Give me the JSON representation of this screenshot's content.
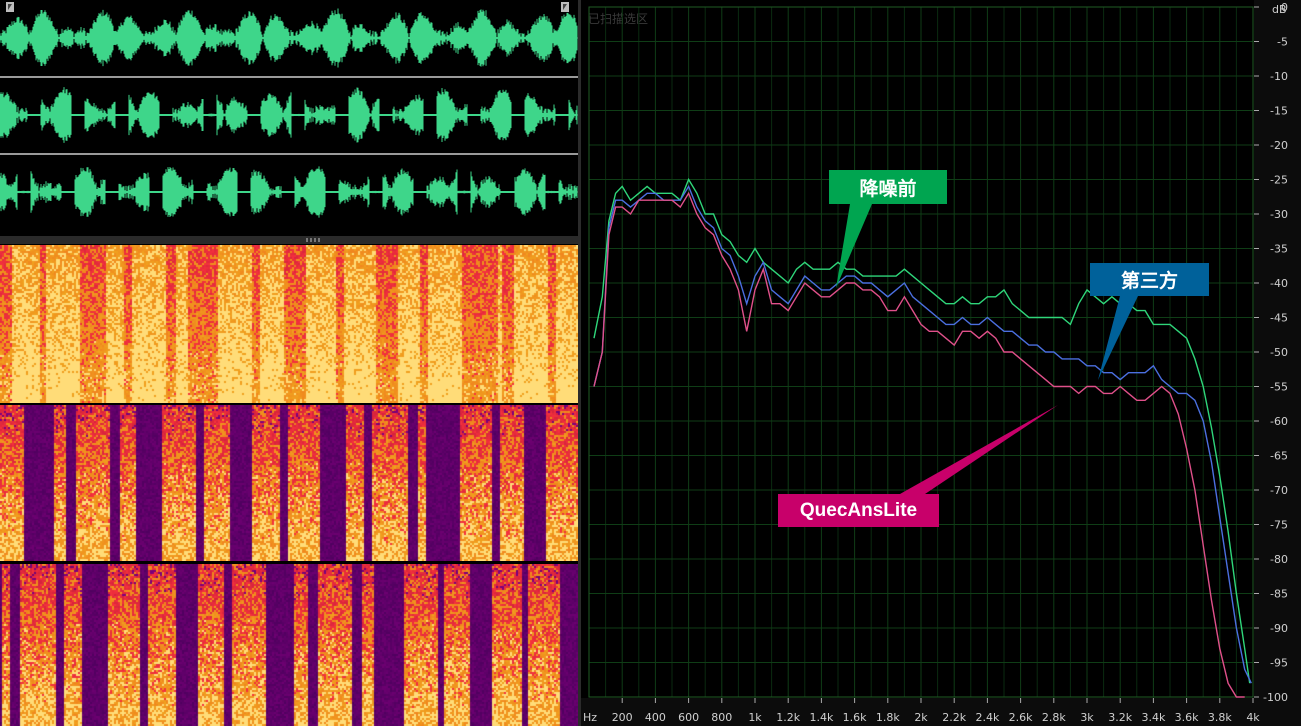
{
  "waveform": {
    "tracks": [
      {
        "id": "original"
      },
      {
        "id": "third-party"
      },
      {
        "id": "quecanslite"
      }
    ],
    "color": "#3ed68a"
  },
  "spectrum_panel": {
    "region_label": "已扫描选区",
    "callouts": {
      "before": {
        "label": "降噪前",
        "color": "#00a550"
      },
      "third_party": {
        "label": "第三方",
        "color": "#00619a"
      },
      "quecans": {
        "label": "QuecAnsLite",
        "color": "#c8006a"
      }
    }
  },
  "chart_data": {
    "type": "line",
    "x_unit": "Hz",
    "y_unit": "dB",
    "xlim": [
      0,
      4000
    ],
    "ylim": [
      -100,
      0
    ],
    "grid": true,
    "x_ticks": [
      {
        "v": 200,
        "label": "200"
      },
      {
        "v": 400,
        "label": "400"
      },
      {
        "v": 600,
        "label": "600"
      },
      {
        "v": 800,
        "label": "800"
      },
      {
        "v": 1000,
        "label": "1k"
      },
      {
        "v": 1200,
        "label": "1.2k"
      },
      {
        "v": 1400,
        "label": "1.4k"
      },
      {
        "v": 1600,
        "label": "1.6k"
      },
      {
        "v": 1800,
        "label": "1.8k"
      },
      {
        "v": 2000,
        "label": "2k"
      },
      {
        "v": 2200,
        "label": "2.2k"
      },
      {
        "v": 2400,
        "label": "2.4k"
      },
      {
        "v": 2600,
        "label": "2.6k"
      },
      {
        "v": 2800,
        "label": "2.8k"
      },
      {
        "v": 3000,
        "label": "3k"
      },
      {
        "v": 3200,
        "label": "3.2k"
      },
      {
        "v": 3400,
        "label": "3.4k"
      },
      {
        "v": 3600,
        "label": "3.6k"
      },
      {
        "v": 3800,
        "label": "3.8k"
      },
      {
        "v": 4000,
        "label": "4k"
      }
    ],
    "y_ticks": [
      0,
      -5,
      -10,
      -15,
      -20,
      -25,
      -30,
      -35,
      -40,
      -45,
      -50,
      -55,
      -60,
      -65,
      -70,
      -75,
      -80,
      -85,
      -90,
      -95,
      -100
    ],
    "series": [
      {
        "color": "#2fd67a",
        "x": [
          30,
          80,
          120,
          160,
          200,
          250,
          300,
          350,
          400,
          450,
          500,
          550,
          600,
          650,
          700,
          750,
          800,
          850,
          900,
          950,
          1000,
          1050,
          1100,
          1150,
          1200,
          1250,
          1300,
          1350,
          1400,
          1450,
          1500,
          1550,
          1600,
          1650,
          1700,
          1750,
          1800,
          1850,
          1900,
          1950,
          2000,
          2050,
          2100,
          2150,
          2200,
          2250,
          2300,
          2350,
          2400,
          2450,
          2500,
          2550,
          2600,
          2650,
          2700,
          2750,
          2800,
          2850,
          2900,
          2950,
          3000,
          3050,
          3100,
          3150,
          3200,
          3250,
          3300,
          3350,
          3400,
          3450,
          3500,
          3550,
          3600,
          3650,
          3700,
          3750,
          3800,
          3850,
          3900,
          3950,
          3980
        ],
        "y": [
          -48,
          -42,
          -31,
          -27,
          -26,
          -28,
          -27,
          -26,
          -27,
          -27,
          -27,
          -28,
          -25,
          -27,
          -30,
          -30,
          -33,
          -34,
          -36,
          -37,
          -35,
          -37,
          -38,
          -39,
          -40,
          -38,
          -37,
          -38,
          -38,
          -38,
          -37,
          -38,
          -38,
          -39,
          -39,
          -39,
          -39,
          -39,
          -38,
          -39,
          -40,
          -41,
          -42,
          -43,
          -43,
          -42,
          -43,
          -43,
          -42,
          -42,
          -41,
          -43,
          -44,
          -45,
          -45,
          -45,
          -45,
          -45,
          -46,
          -43,
          -41,
          -42,
          -43,
          -42,
          -43,
          -43,
          -44,
          -44,
          -46,
          -46,
          -46,
          -47,
          -48,
          -51,
          -55,
          -61,
          -68,
          -76,
          -85,
          -93,
          -98
        ]
      },
      {
        "color": "#4b6fe0",
        "x": [
          30,
          80,
          120,
          160,
          200,
          250,
          300,
          350,
          400,
          450,
          500,
          550,
          600,
          650,
          700,
          750,
          800,
          850,
          900,
          950,
          1000,
          1050,
          1100,
          1150,
          1200,
          1250,
          1300,
          1350,
          1400,
          1450,
          1500,
          1550,
          1600,
          1650,
          1700,
          1750,
          1800,
          1850,
          1900,
          1950,
          2000,
          2050,
          2100,
          2150,
          2200,
          2250,
          2300,
          2350,
          2400,
          2450,
          2500,
          2550,
          2600,
          2650,
          2700,
          2750,
          2800,
          2850,
          2900,
          2950,
          3000,
          3050,
          3100,
          3150,
          3200,
          3250,
          3300,
          3350,
          3400,
          3450,
          3500,
          3550,
          3600,
          3650,
          3700,
          3750,
          3800,
          3850,
          3900,
          3950,
          3990
        ],
        "y": [
          -55,
          -50,
          -32,
          -28,
          -28,
          -29,
          -28,
          -27,
          -27,
          -28,
          -28,
          -28,
          -26,
          -29,
          -31,
          -32,
          -35,
          -36,
          -39,
          -43,
          -39,
          -37,
          -41,
          -42,
          -43,
          -41,
          -39,
          -40,
          -41,
          -41,
          -40,
          -39,
          -39,
          -40,
          -40,
          -41,
          -42,
          -41,
          -40,
          -42,
          -43,
          -44,
          -45,
          -46,
          -46,
          -45,
          -46,
          -46,
          -45,
          -46,
          -47,
          -47,
          -48,
          -49,
          -49,
          -50,
          -50,
          -51,
          -51,
          -51,
          -52,
          -52,
          -53,
          -53,
          -54,
          -53,
          -53,
          -53,
          -52,
          -54,
          -55,
          -56,
          -56,
          -57,
          -60,
          -66,
          -74,
          -82,
          -90,
          -96,
          -98
        ]
      },
      {
        "color": "#e0508a",
        "x": [
          30,
          80,
          120,
          160,
          200,
          250,
          300,
          350,
          400,
          450,
          500,
          550,
          600,
          650,
          700,
          750,
          800,
          850,
          900,
          950,
          1000,
          1050,
          1100,
          1150,
          1200,
          1250,
          1300,
          1350,
          1400,
          1450,
          1500,
          1550,
          1600,
          1650,
          1700,
          1750,
          1800,
          1850,
          1900,
          1950,
          2000,
          2050,
          2100,
          2150,
          2200,
          2250,
          2300,
          2350,
          2400,
          2450,
          2500,
          2550,
          2600,
          2650,
          2700,
          2750,
          2800,
          2850,
          2900,
          2950,
          3000,
          3050,
          3100,
          3150,
          3200,
          3250,
          3300,
          3350,
          3400,
          3450,
          3500,
          3550,
          3600,
          3650,
          3700,
          3750,
          3800,
          3850,
          3900,
          3950
        ],
        "y": [
          -55,
          -50,
          -33,
          -29,
          -29,
          -30,
          -28,
          -28,
          -28,
          -28,
          -28,
          -29,
          -27,
          -30,
          -32,
          -33,
          -36,
          -38,
          -41,
          -47,
          -41,
          -38,
          -43,
          -43,
          -44,
          -42,
          -40,
          -41,
          -42,
          -42,
          -41,
          -40,
          -40,
          -41,
          -41,
          -42,
          -44,
          -44,
          -42,
          -44,
          -46,
          -47,
          -47,
          -48,
          -49,
          -47,
          -47,
          -48,
          -47,
          -48,
          -50,
          -50,
          -51,
          -52,
          -53,
          -54,
          -55,
          -55,
          -55,
          -56,
          -55,
          -55,
          -56,
          -56,
          -55,
          -56,
          -57,
          -57,
          -56,
          -55,
          -56,
          -59,
          -64,
          -70,
          -78,
          -86,
          -93,
          -98,
          -100,
          -100
        ]
      }
    ]
  }
}
